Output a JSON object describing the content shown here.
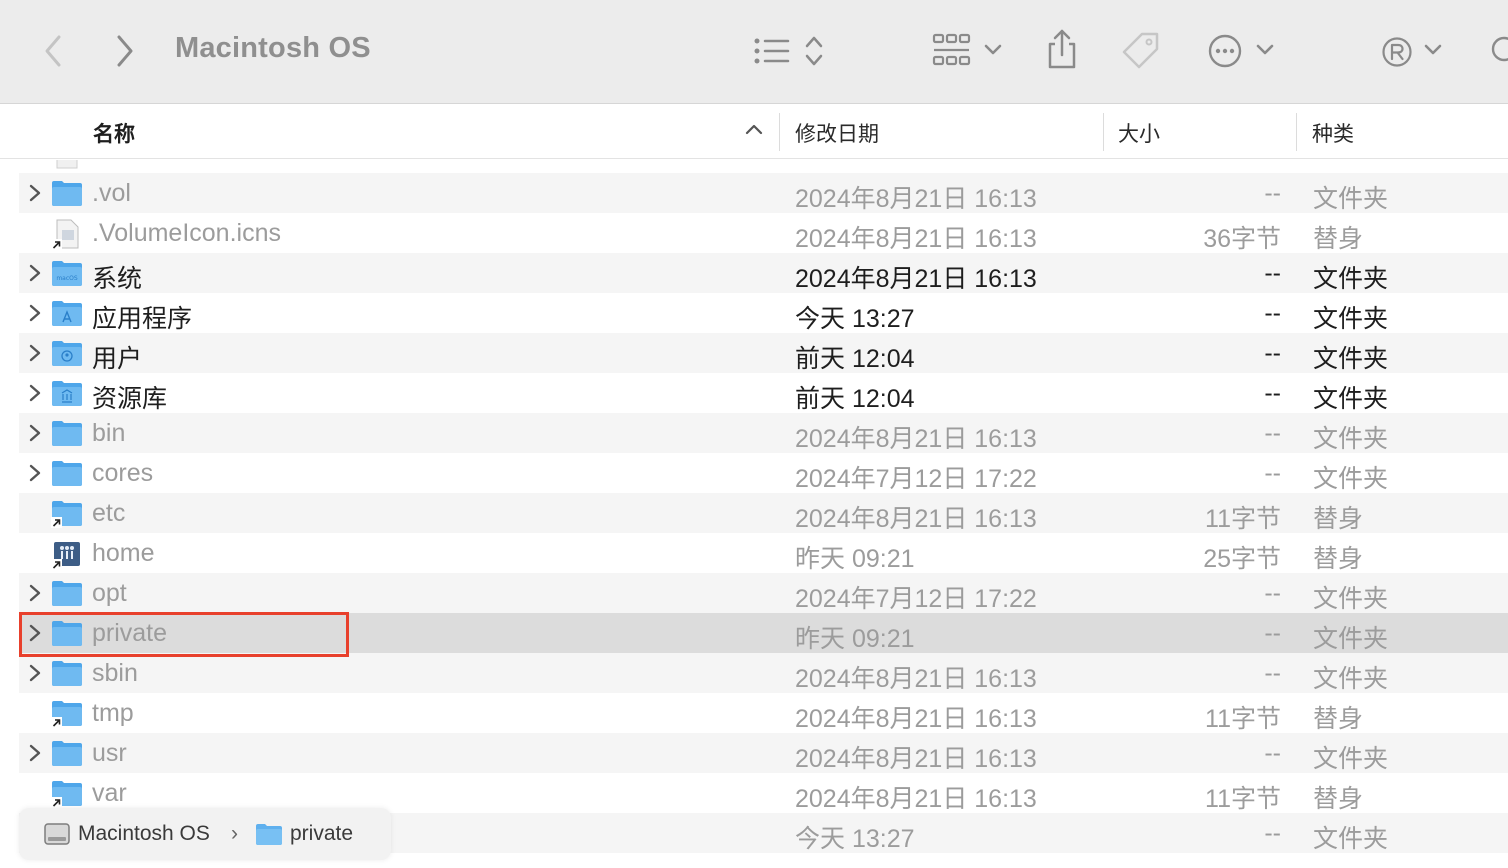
{
  "window": {
    "title": "Macintosh OS"
  },
  "toolbar": {
    "icons": [
      "chevron-left",
      "chevron-right",
      "list-view",
      "sort-updown",
      "grid-view",
      "chevron-down",
      "share",
      "tag",
      "more",
      "chevron-down",
      "account-r",
      "chevron-down",
      "search"
    ]
  },
  "columns": {
    "name": "名称",
    "date": "修改日期",
    "size": "大小",
    "kind": "种类"
  },
  "rows": [
    {
      "name": ".vol",
      "date": "2024年8月21日 16:13",
      "size": "--",
      "kind": "文件夹",
      "icon": "folder",
      "expandable": true,
      "dim": true
    },
    {
      "name": ".VolumeIcon.icns",
      "date": "2024年8月21日 16:13",
      "size": "36字节",
      "kind": "替身",
      "icon": "alias-doc",
      "expandable": false,
      "dim": true
    },
    {
      "name": "系统",
      "date": "2024年8月21日 16:13",
      "size": "--",
      "kind": "文件夹",
      "icon": "folder-macos",
      "expandable": true,
      "dim": false
    },
    {
      "name": "应用程序",
      "date": "今天 13:27",
      "size": "--",
      "kind": "文件夹",
      "icon": "folder-apps",
      "expandable": true,
      "dim": false
    },
    {
      "name": "用户",
      "date": "前天 12:04",
      "size": "--",
      "kind": "文件夹",
      "icon": "folder-users",
      "expandable": true,
      "dim": false
    },
    {
      "name": "资源库",
      "date": "前天 12:04",
      "size": "--",
      "kind": "文件夹",
      "icon": "folder-library",
      "expandable": true,
      "dim": false
    },
    {
      "name": "bin",
      "date": "2024年8月21日 16:13",
      "size": "--",
      "kind": "文件夹",
      "icon": "folder",
      "expandable": true,
      "dim": true
    },
    {
      "name": "cores",
      "date": "2024年7月12日 17:22",
      "size": "--",
      "kind": "文件夹",
      "icon": "folder",
      "expandable": true,
      "dim": true
    },
    {
      "name": "etc",
      "date": "2024年8月21日 16:13",
      "size": "11字节",
      "kind": "替身",
      "icon": "folder-alias",
      "expandable": false,
      "dim": true
    },
    {
      "name": "home",
      "date": "昨天 09:21",
      "size": "25字节",
      "kind": "替身",
      "icon": "home-alias",
      "expandable": false,
      "dim": true
    },
    {
      "name": "opt",
      "date": "2024年7月12日 17:22",
      "size": "--",
      "kind": "文件夹",
      "icon": "folder",
      "expandable": true,
      "dim": true
    },
    {
      "name": "private",
      "date": "昨天 09:21",
      "size": "--",
      "kind": "文件夹",
      "icon": "folder",
      "expandable": true,
      "dim": true,
      "selected": true
    },
    {
      "name": "sbin",
      "date": "2024年8月21日 16:13",
      "size": "--",
      "kind": "文件夹",
      "icon": "folder",
      "expandable": true,
      "dim": true
    },
    {
      "name": "tmp",
      "date": "2024年8月21日 16:13",
      "size": "11字节",
      "kind": "替身",
      "icon": "folder-alias",
      "expandable": false,
      "dim": true
    },
    {
      "name": "usr",
      "date": "2024年8月21日 16:13",
      "size": "--",
      "kind": "文件夹",
      "icon": "folder",
      "expandable": true,
      "dim": true
    },
    {
      "name": "var",
      "date": "2024年8月21日 16:13",
      "size": "11字节",
      "kind": "替身",
      "icon": "folder-alias",
      "expandable": false,
      "dim": true
    },
    {
      "name": "",
      "date": "今天 13:27",
      "size": "--",
      "kind": "文件夹",
      "icon": "none",
      "expandable": false,
      "dim": true
    }
  ],
  "pathbar": {
    "disk": "Macintosh OS",
    "separator": "›",
    "folder": "private"
  },
  "colors": {
    "folder": "#5fb0ee",
    "highlight": "#e8402c",
    "selected_row": "#dcdcdc"
  }
}
